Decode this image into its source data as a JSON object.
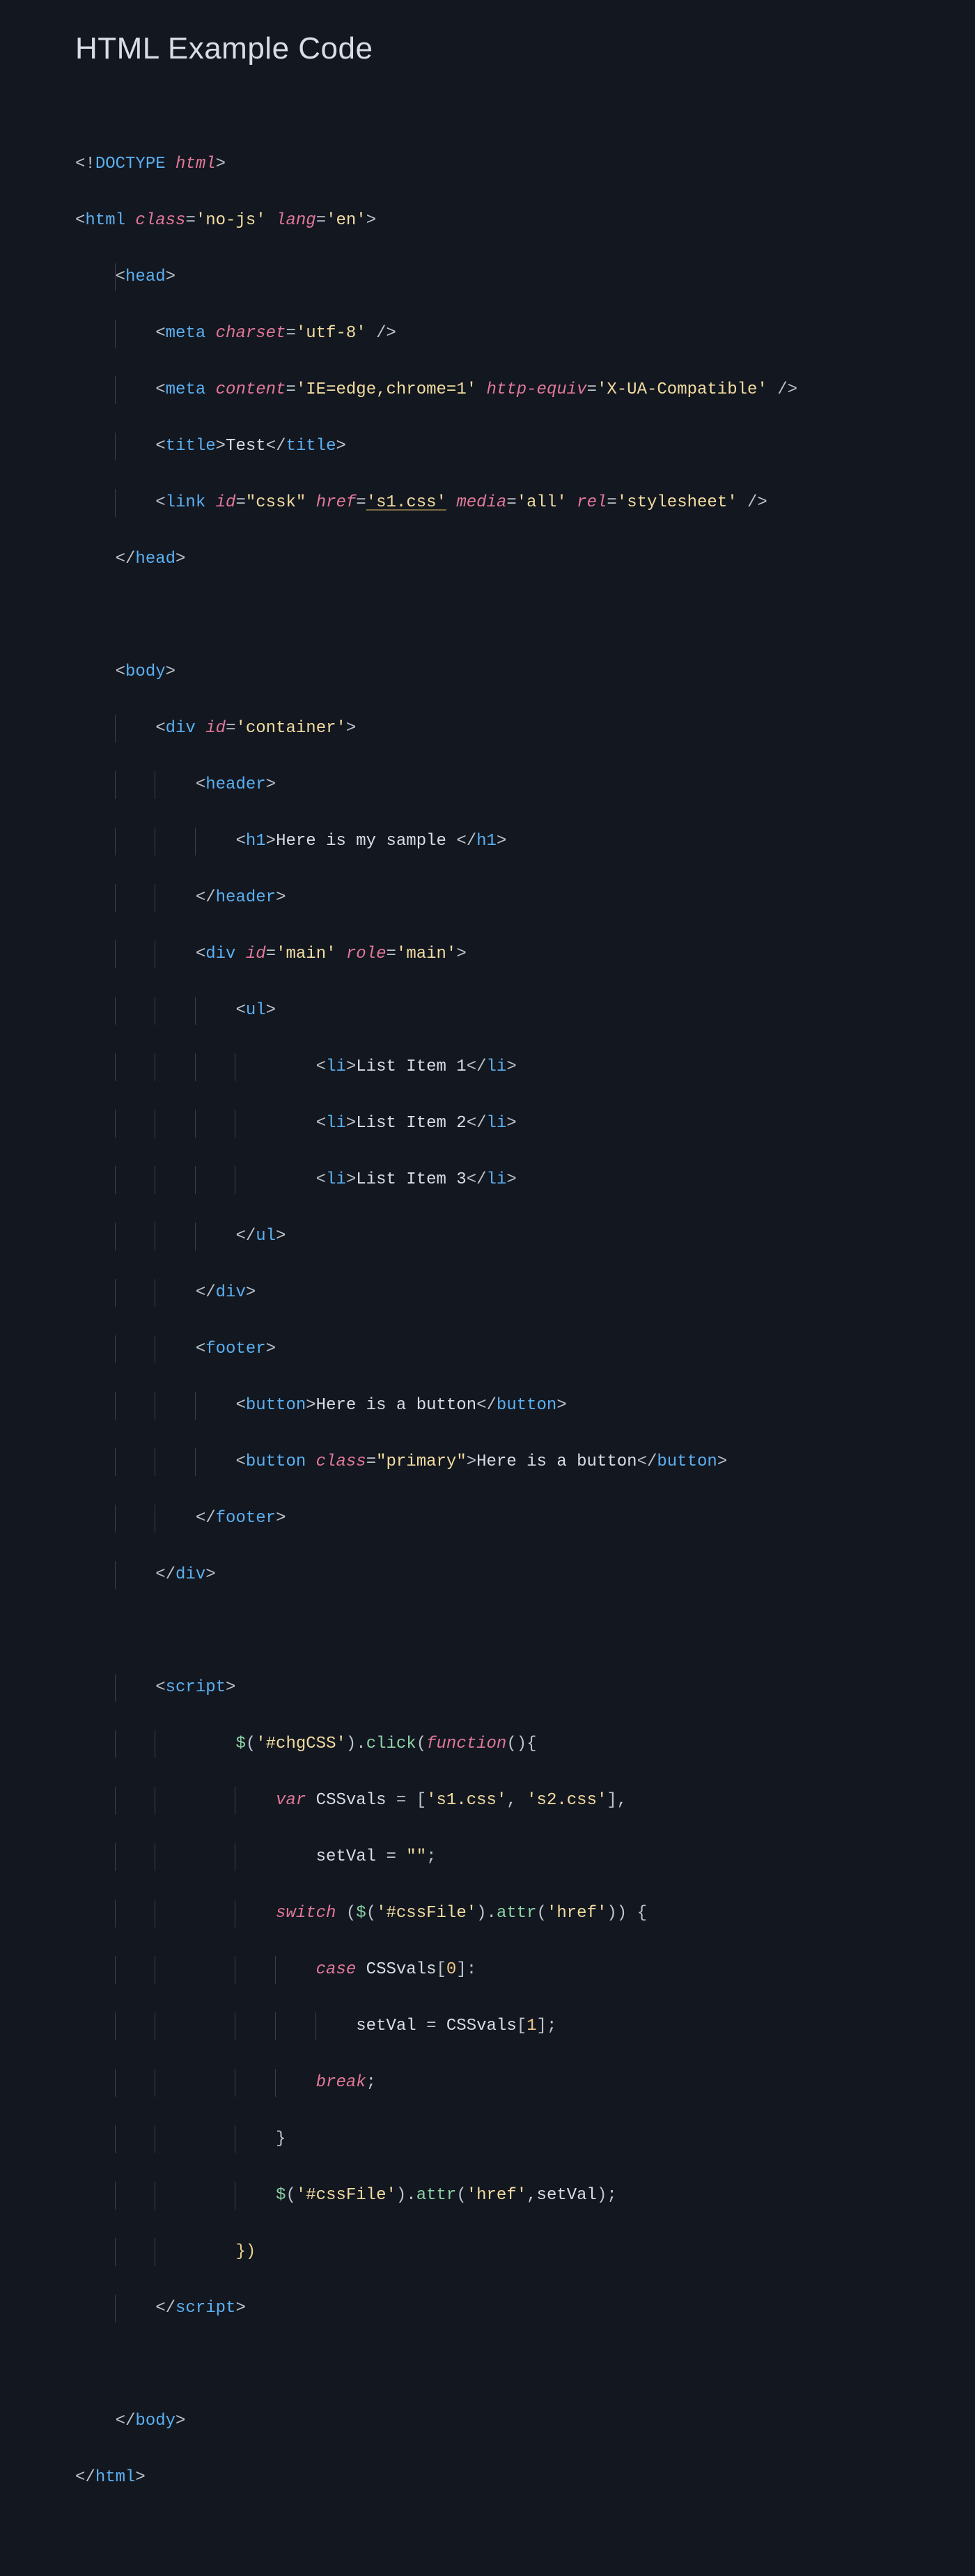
{
  "title": "HTML Example Code",
  "doctype": {
    "open": "<!",
    "kw": "DOCTYPE",
    "name": "html",
    "close": ">"
  },
  "html_open": {
    "tag": "html",
    "class_attr": "class",
    "class_val": "'no-js'",
    "lang_attr": "lang",
    "lang_val": "'en'"
  },
  "head": {
    "tag": "head",
    "meta1": {
      "tag": "meta",
      "charset_attr": "charset",
      "charset_val": "'utf-8'"
    },
    "meta2": {
      "tag": "meta",
      "content_attr": "content",
      "content_val": "'IE=edge,chrome=1'",
      "httpequiv_attr": "http-equiv",
      "httpequiv_val": "'X-UA-Compatible'"
    },
    "title": {
      "tag": "title",
      "text": "Test"
    },
    "link": {
      "tag": "link",
      "id_attr": "id",
      "id_val": "\"cssk\"",
      "href_attr": "href",
      "href_val": "'s1.css'",
      "media_attr": "media",
      "media_val": "'all'",
      "rel_attr": "rel",
      "rel_val": "'stylesheet'"
    }
  },
  "body_tag": "body",
  "container": {
    "tag": "div",
    "id_attr": "id",
    "id_val": "'container'",
    "header": {
      "tag": "header",
      "h1_tag": "h1",
      "h1_text": "Here is my sample "
    },
    "main": {
      "tag": "div",
      "id_attr": "id",
      "id_val": "'main'",
      "role_attr": "role",
      "role_val": "'main'",
      "ul_tag": "ul",
      "li_tag": "li",
      "items": [
        "List Item 1",
        "List Item 2",
        "List Item 3"
      ]
    },
    "footer": {
      "tag": "footer",
      "button_tag": "button",
      "btn1_text": "Here is a button",
      "btn2_class_attr": "class",
      "btn2_class_val": "\"primary\"",
      "btn2_text": "Here is a button"
    }
  },
  "script": {
    "tag": "script",
    "jq": "$",
    "sel1": "'#chgCSS'",
    "click": "click",
    "fn_kw": "function",
    "var_kw": "var",
    "cssvals_id": "CSSvals",
    "arr_open": "[",
    "s1": "'s1.css'",
    "s2": "'s2.css'",
    "arr_close": "]",
    "setval_id": "setVal",
    "empty_str": "\"\"",
    "switch_kw": "switch",
    "sel2": "'#cssFile'",
    "attr_m": "attr",
    "href_str": "'href'",
    "case_kw": "case",
    "zero": "0",
    "one": "1",
    "break_kw": "break",
    "close_paren_brace": "})"
  },
  "punct": {
    "lt": "<",
    "gt": ">",
    "slash": "/",
    "eq": "=",
    "sc_gt": " />",
    "ob": "{",
    "cb": "}",
    "op": "(",
    "cp": ")",
    "obk": "[",
    "cbk": "]",
    "comma": ",",
    "colon": ":",
    "semi": ";",
    "dot": "."
  }
}
